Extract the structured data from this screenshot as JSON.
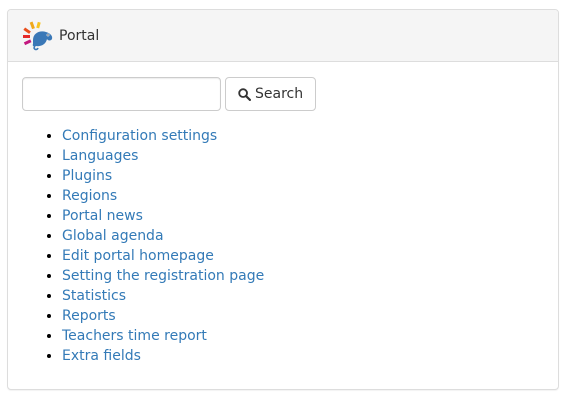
{
  "panel": {
    "title": "Portal",
    "logo_icon": "chameleon-logo-icon"
  },
  "search": {
    "value": "",
    "placeholder": "",
    "button_label": "Search",
    "button_icon": "search-icon"
  },
  "links": [
    {
      "label": "Configuration settings"
    },
    {
      "label": "Languages"
    },
    {
      "label": "Plugins"
    },
    {
      "label": "Regions"
    },
    {
      "label": "Portal news"
    },
    {
      "label": "Global agenda"
    },
    {
      "label": "Edit portal homepage"
    },
    {
      "label": "Setting the registration page"
    },
    {
      "label": "Statistics"
    },
    {
      "label": "Reports"
    },
    {
      "label": "Teachers time report"
    },
    {
      "label": "Extra fields"
    }
  ],
  "colors": {
    "link": "#337ab7",
    "heading_bg": "#f5f5f5",
    "border": "#dddddd"
  }
}
